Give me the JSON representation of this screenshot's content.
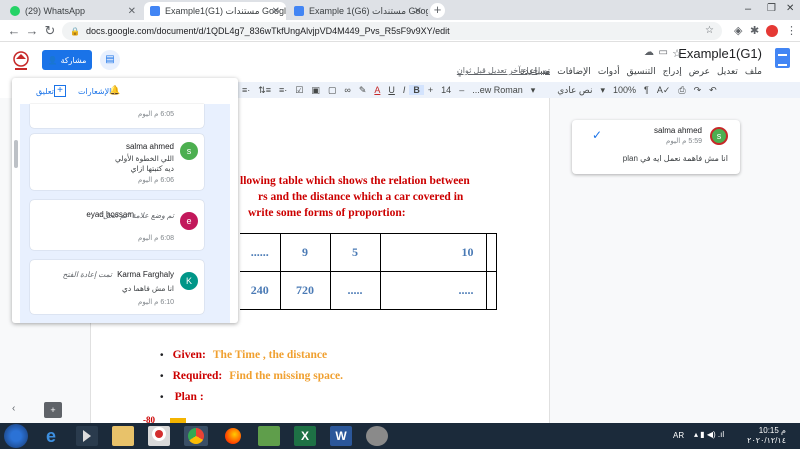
{
  "browser": {
    "tabs": [
      {
        "title": "(29) WhatsApp",
        "active": false,
        "icon_color": "#25d366"
      },
      {
        "title": "Example1(G1) مستندات Google",
        "active": true,
        "icon_color": "#4285f4"
      },
      {
        "title": "Example 1(G6) مستندات Google",
        "active": false,
        "icon_color": "#4285f4"
      }
    ],
    "new_tab": "+",
    "url": "docs.google.com/document/d/1QDL4g7_836wTkfUngAlvjpVD4M449_Pvs_R5sF9v9XY/edit"
  },
  "docs": {
    "title": "Example1(G1)",
    "menu": [
      "ملف",
      "تعديل",
      "عرض",
      "إدراج",
      "التنسيق",
      "أدوات",
      "الإضافات",
      "مساعدة"
    ],
    "last_edit": "تم إجراء آخر تعديل قبل ثوانٍ",
    "share_label": "مشاركة",
    "toolbar": {
      "zoom": "100%",
      "style": "نص عادي",
      "font": "...ew Roman",
      "size": "14",
      "bold": "B",
      "italic": "I",
      "underline": "U",
      "text_color": "A"
    }
  },
  "comments_panel": {
    "notifications": "الإشعارات",
    "add": "تعليق",
    "top_time": "6:05 م اليوم",
    "cards": [
      {
        "author": "salma ahmed",
        "initial": "s",
        "color": "#4caf50",
        "lines": [
          "اللي الخطوة الأولي",
          "ديه كتبتها ازاي"
        ],
        "time": "6:06 م اليوم"
      },
      {
        "author": "eyad hossam",
        "initial": "e",
        "color": "#c2185b",
        "lines": [
          "تم وضع علامة \"تم الحل\""
        ],
        "time": "6:08 م اليوم"
      },
      {
        "author": "Karma Farghaly",
        "initial": "K",
        "color": "#009688",
        "lines": [
          "تمت إعادة الفتح",
          "انا مش فاهما دي"
        ],
        "time": "6:10 م اليوم"
      }
    ]
  },
  "right_comment": {
    "author": "salma ahmed",
    "initial": "s",
    "time": "5:59 م اليوم",
    "text": "انا مش فاهمة نعمل ايه في plan"
  },
  "document": {
    "para_lines": [
      "llowing table which shows the relation between",
      "rs and the distance which a car covered in",
      "write some forms of proportion:"
    ],
    "table_row1": [
      "......",
      "9",
      "5",
      "10",
      ""
    ],
    "table_row2": [
      "240",
      "720",
      ".....",
      ".....",
      ""
    ],
    "bullets": [
      {
        "label": "Given:",
        "value": "The  Time    , the distance"
      },
      {
        "label": "Required:",
        "value": "Find the missing space."
      },
      {
        "label": "Plan :",
        "value": ""
      }
    ],
    "cut_number": "-80"
  },
  "taskbar": {
    "lang": "AR",
    "time": "10:15 م",
    "date": "٢٠٢٠/١٢/١٤"
  }
}
